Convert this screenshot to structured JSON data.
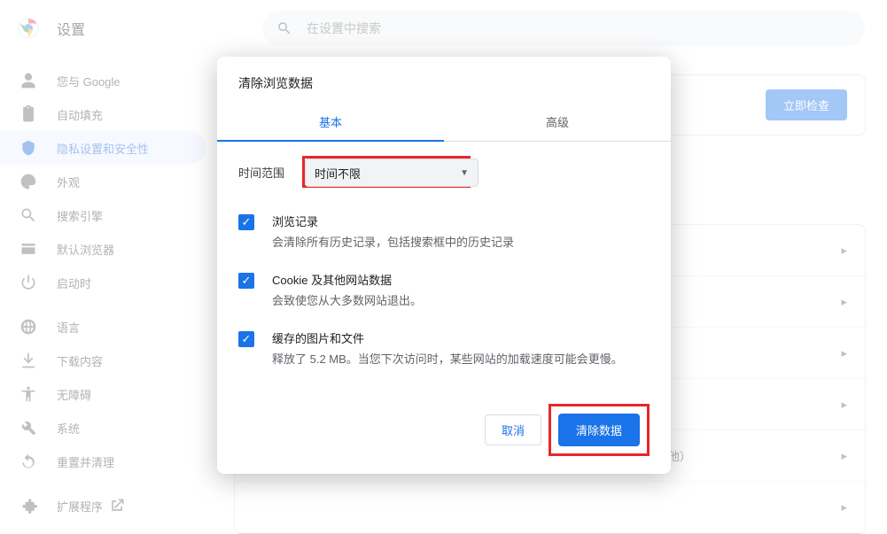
{
  "header": {
    "title": "设置",
    "search_placeholder": "在设置中搜索"
  },
  "sidebar": {
    "items": [
      {
        "label": "您与 Google"
      },
      {
        "label": "自动填充"
      },
      {
        "label": "隐私设置和安全性"
      },
      {
        "label": "外观"
      },
      {
        "label": "搜索引擎"
      },
      {
        "label": "默认浏览器"
      },
      {
        "label": "启动时"
      }
    ],
    "items2": [
      {
        "label": "语言"
      },
      {
        "label": "下载内容"
      },
      {
        "label": "无障碍"
      },
      {
        "label": "系统"
      },
      {
        "label": "重置并清理"
      }
    ],
    "ext_label": "扩展程序"
  },
  "main": {
    "check_button": "立即检查",
    "site_settings_desc": "控制网站可以使用和显示什么信息（如位置信息、摄像头、弹出式窗口及其他）"
  },
  "dialog": {
    "title": "清除浏览数据",
    "tabs": {
      "basic": "基本",
      "advanced": "高级"
    },
    "range_label": "时间范围",
    "range_value": "时间不限",
    "items": [
      {
        "title": "浏览记录",
        "desc": "会清除所有历史记录，包括搜索框中的历史记录"
      },
      {
        "title": "Cookie 及其他网站数据",
        "desc": "会致使您从大多数网站退出。"
      },
      {
        "title": "缓存的图片和文件",
        "desc": "释放了 5.2 MB。当您下次访问时，某些网站的加载速度可能会更慢。"
      }
    ],
    "cancel": "取消",
    "confirm": "清除数据"
  }
}
